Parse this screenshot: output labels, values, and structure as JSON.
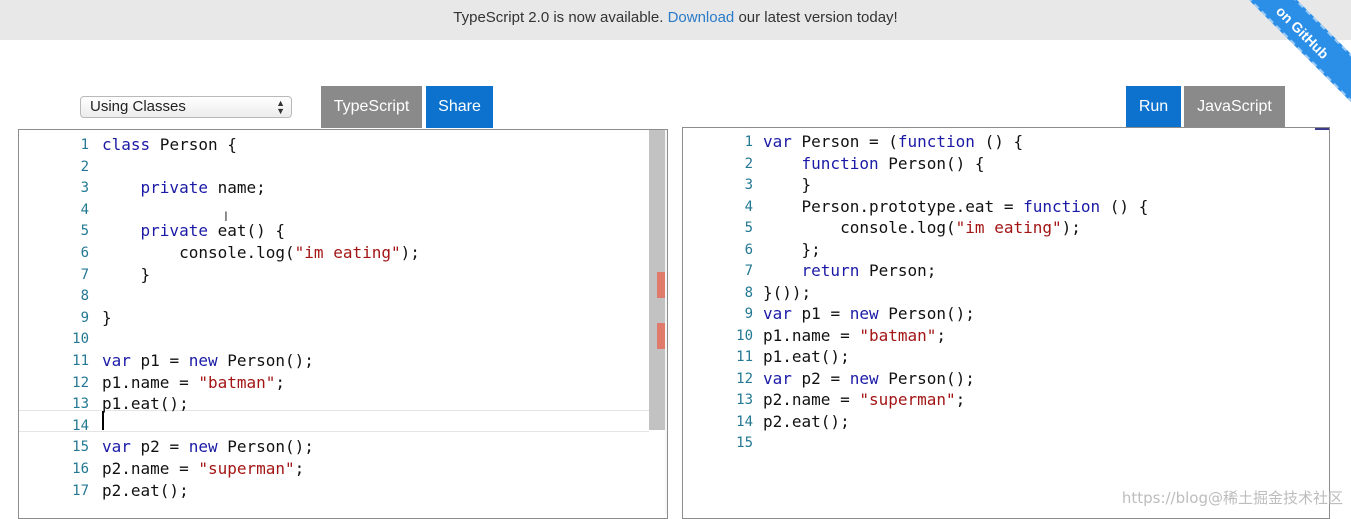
{
  "banner": {
    "text_before": "TypeScript 2.0 is now available. ",
    "link": "Download",
    "text_after": " our latest version today!"
  },
  "ribbon": {
    "label": "on GitHub"
  },
  "toolbar": {
    "example_select": "Using Classes",
    "typescript_tab": "TypeScript",
    "share": "Share",
    "run": "Run",
    "javascript_tab": "JavaScript"
  },
  "ts_editor": {
    "lines": [
      {
        "n": "1",
        "tokens": [
          {
            "t": "class",
            "c": "kw"
          },
          {
            "t": " Person {",
            "c": ""
          }
        ]
      },
      {
        "n": "2",
        "tokens": []
      },
      {
        "n": "3",
        "tokens": [
          {
            "t": "    ",
            "c": ""
          },
          {
            "t": "private",
            "c": "kw"
          },
          {
            "t": " name;",
            "c": ""
          }
        ]
      },
      {
        "n": "4",
        "tokens": []
      },
      {
        "n": "5",
        "tokens": [
          {
            "t": "    ",
            "c": ""
          },
          {
            "t": "private",
            "c": "kw"
          },
          {
            "t": " eat() {",
            "c": ""
          }
        ]
      },
      {
        "n": "6",
        "tokens": [
          {
            "t": "        console.log(",
            "c": ""
          },
          {
            "t": "\"im eating\"",
            "c": "str"
          },
          {
            "t": ");",
            "c": ""
          }
        ]
      },
      {
        "n": "7",
        "tokens": [
          {
            "t": "    }",
            "c": ""
          }
        ]
      },
      {
        "n": "8",
        "tokens": []
      },
      {
        "n": "9",
        "tokens": [
          {
            "t": "}",
            "c": ""
          }
        ]
      },
      {
        "n": "10",
        "tokens": []
      },
      {
        "n": "11",
        "tokens": [
          {
            "t": "var",
            "c": "kw"
          },
          {
            "t": " p1 = ",
            "c": ""
          },
          {
            "t": "new",
            "c": "kw"
          },
          {
            "t": " Person();",
            "c": ""
          }
        ]
      },
      {
        "n": "12",
        "tokens": [
          {
            "t": "p1.name = ",
            "c": ""
          },
          {
            "t": "\"batman\"",
            "c": "str"
          },
          {
            "t": ";",
            "c": ""
          }
        ]
      },
      {
        "n": "13",
        "tokens": [
          {
            "t": "p1.eat();",
            "c": ""
          }
        ]
      },
      {
        "n": "14",
        "tokens": []
      },
      {
        "n": "15",
        "tokens": [
          {
            "t": "var",
            "c": "kw"
          },
          {
            "t": " p2 = ",
            "c": ""
          },
          {
            "t": "new",
            "c": "kw"
          },
          {
            "t": " Person();",
            "c": ""
          }
        ]
      },
      {
        "n": "16",
        "tokens": [
          {
            "t": "p2.name = ",
            "c": ""
          },
          {
            "t": "\"superman\"",
            "c": "str"
          },
          {
            "t": ";",
            "c": ""
          }
        ]
      },
      {
        "n": "17",
        "tokens": [
          {
            "t": "p2.eat();",
            "c": ""
          }
        ]
      }
    ]
  },
  "js_editor": {
    "lines": [
      {
        "n": "1",
        "tokens": [
          {
            "t": "var",
            "c": "kw"
          },
          {
            "t": " Person = (",
            "c": ""
          },
          {
            "t": "function",
            "c": "kw"
          },
          {
            "t": " () {",
            "c": ""
          }
        ]
      },
      {
        "n": "2",
        "tokens": [
          {
            "t": "    ",
            "c": ""
          },
          {
            "t": "function",
            "c": "kw"
          },
          {
            "t": " Person() {",
            "c": ""
          }
        ]
      },
      {
        "n": "3",
        "tokens": [
          {
            "t": "    }",
            "c": ""
          }
        ]
      },
      {
        "n": "4",
        "tokens": [
          {
            "t": "    Person.prototype.eat = ",
            "c": ""
          },
          {
            "t": "function",
            "c": "kw"
          },
          {
            "t": " () {",
            "c": ""
          }
        ]
      },
      {
        "n": "5",
        "tokens": [
          {
            "t": "        console.log(",
            "c": ""
          },
          {
            "t": "\"im eating\"",
            "c": "str"
          },
          {
            "t": ");",
            "c": ""
          }
        ]
      },
      {
        "n": "6",
        "tokens": [
          {
            "t": "    };",
            "c": ""
          }
        ]
      },
      {
        "n": "7",
        "tokens": [
          {
            "t": "    ",
            "c": ""
          },
          {
            "t": "return",
            "c": "kw"
          },
          {
            "t": " Person;",
            "c": ""
          }
        ]
      },
      {
        "n": "8",
        "tokens": [
          {
            "t": "}());",
            "c": ""
          }
        ]
      },
      {
        "n": "9",
        "tokens": [
          {
            "t": "var",
            "c": "kw"
          },
          {
            "t": " p1 = ",
            "c": ""
          },
          {
            "t": "new",
            "c": "kw"
          },
          {
            "t": " Person();",
            "c": ""
          }
        ]
      },
      {
        "n": "10",
        "tokens": [
          {
            "t": "p1.name = ",
            "c": ""
          },
          {
            "t": "\"batman\"",
            "c": "str"
          },
          {
            "t": ";",
            "c": ""
          }
        ]
      },
      {
        "n": "11",
        "tokens": [
          {
            "t": "p1.eat();",
            "c": ""
          }
        ]
      },
      {
        "n": "12",
        "tokens": [
          {
            "t": "var",
            "c": "kw"
          },
          {
            "t": " p2 = ",
            "c": ""
          },
          {
            "t": "new",
            "c": "kw"
          },
          {
            "t": " Person();",
            "c": ""
          }
        ]
      },
      {
        "n": "13",
        "tokens": [
          {
            "t": "p2.name = ",
            "c": ""
          },
          {
            "t": "\"superman\"",
            "c": "str"
          },
          {
            "t": ";",
            "c": ""
          }
        ]
      },
      {
        "n": "14",
        "tokens": [
          {
            "t": "p2.eat();",
            "c": ""
          }
        ]
      },
      {
        "n": "15",
        "tokens": []
      }
    ]
  },
  "watermark": "https://blog@稀土掘金技术社区",
  "colors": {
    "accent": "#0c72cd",
    "keyword": "#1a1aa6",
    "string": "#a31515",
    "line_number": "#237893"
  }
}
